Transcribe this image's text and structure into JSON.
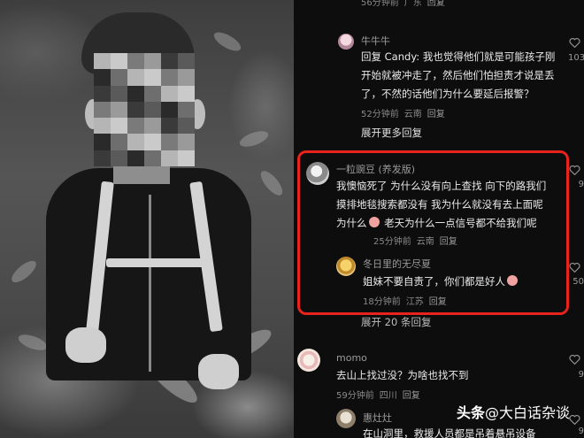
{
  "comments": [
    {
      "id": "top-partial",
      "time": "56分钟前",
      "location": "广东",
      "reply_label": "回复"
    },
    {
      "id": "niuniuniu",
      "user": "牛牛牛",
      "text": "回复 Candy: 我也觉得他们就是可能孩子刚开始就被冲走了，然后他们怕担责才说是丢了，不然的话他们为什么要延后报警？",
      "time": "52分钟前",
      "location": "云南",
      "reply_label": "回复",
      "likes": "103"
    },
    {
      "id": "yilivandou",
      "user": "一粒豌豆 (养发版)",
      "text": "我懊恼死了 为什么没有向上查找 向下的路我们摸排地毯搜索都没有 我为什么就没有去上面呢 为什么",
      "text_tail": "老天为什么一点信号都不给我们呢",
      "time": "25分钟前",
      "location": "云南",
      "reply_label": "回复",
      "likes": "9"
    },
    {
      "id": "dongrili",
      "user": "冬日里的无尽夏",
      "text": "姐妹不要自责了，你们都是好人",
      "time": "18分钟前",
      "location": "江苏",
      "reply_label": "回复",
      "likes": "50"
    },
    {
      "id": "momo",
      "user": "momo",
      "text": "去山上找过没？为啥也找不到",
      "time": "59分钟前",
      "location": "四川",
      "reply_label": "回复",
      "likes": "9"
    },
    {
      "id": "huizaozao",
      "user": "惠灶灶",
      "text": "在山洞里，救援人员都是吊着悬吊设备",
      "likes": "9"
    }
  ],
  "expand_more": "展开更多回复",
  "expand_partial": "展开 20 条回复",
  "watermark": {
    "logo": "头条",
    "handle": "@大白话杂谈"
  },
  "colors": {
    "highlight": "#e8221c",
    "background": "#0d0d0d"
  },
  "icons": {
    "like": "heart-outline-icon",
    "emoji_shy": "blush-emoji-icon"
  }
}
